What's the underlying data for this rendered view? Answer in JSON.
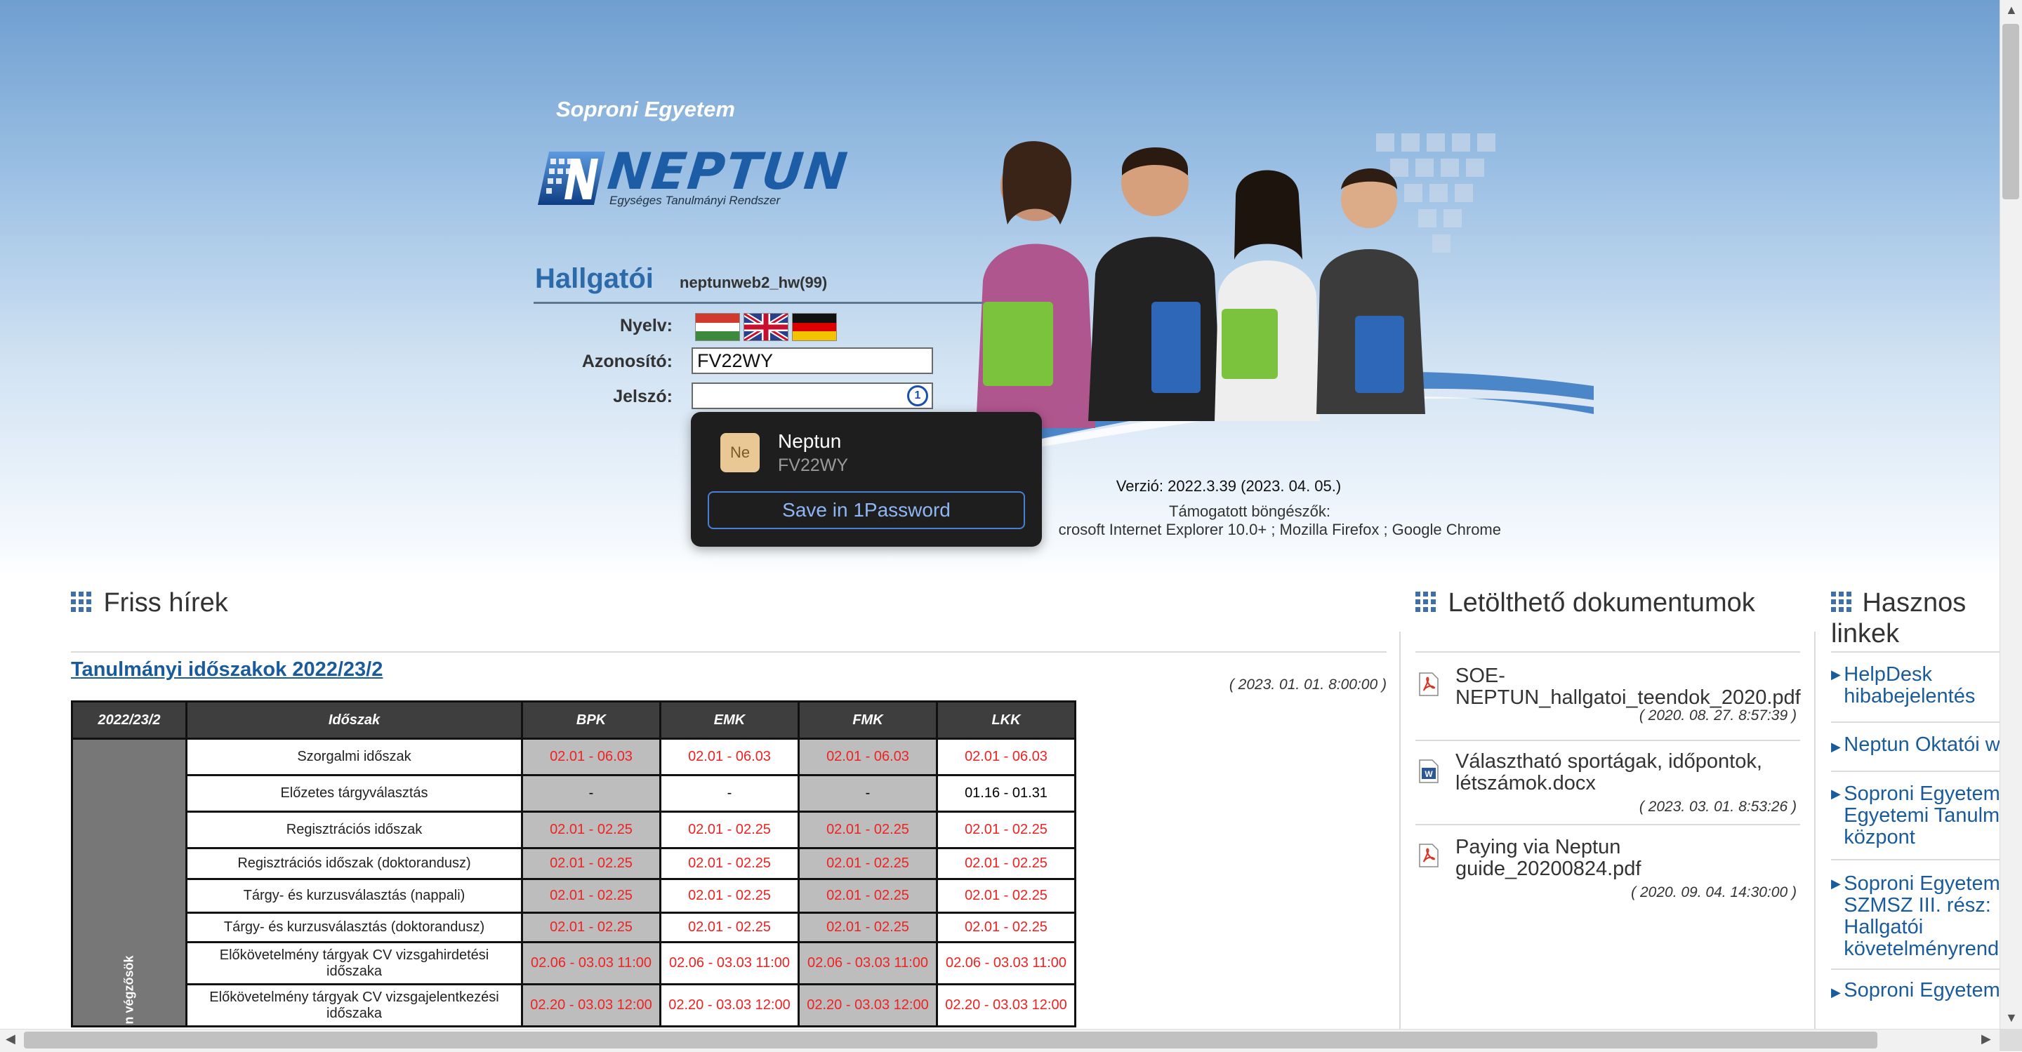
{
  "header": {
    "university": "Soproni Egyetem",
    "logo_word": "NEPTUN",
    "logo_sub": "Egységes Tanulmányi Rendszer",
    "portal": "Hallgatói",
    "server": "neptunweb2_hw(99)"
  },
  "login": {
    "language_label": "Nyelv:",
    "username_label": "Azonosító:",
    "username_value": "FV22WY",
    "password_label": "Jelszó:",
    "password_value": "",
    "onepassword_icon": "1password-icon"
  },
  "popup": {
    "badge": "Ne",
    "title": "Neptun",
    "subtitle": "FV22WY",
    "save_button": "Save in 1Password"
  },
  "version": {
    "text": "Verzió: 2022.3.39 (2023. 04. 05.)",
    "supported_label": "Támogatott böngészők:",
    "supported_list": "crosoft Internet Explorer 10.0+ ; Mozilla Firefox ; Google Chrome"
  },
  "news": {
    "title": "Friss hírek",
    "item_title": "Tanulmányi időszakok 2022/23/2",
    "item_date": "( 2023. 01. 01. 8:00:00 )",
    "table": {
      "headers": [
        "2022/23/2",
        "Időszak",
        "BPK",
        "EMK",
        "FMK",
        "LKK"
      ],
      "side_label": "n végzősök",
      "rows": [
        {
          "period": "Szorgalmi időszak",
          "cells": [
            "02.01 - 06.03",
            "02.01 - 06.03",
            "02.01 - 06.03",
            "02.01 - 06.03"
          ]
        },
        {
          "period": "Előzetes tárgyválasztás",
          "cells": [
            "-",
            "-",
            "-",
            "01.16 - 01.31"
          ]
        },
        {
          "period": "Regisztrációs időszak",
          "cells": [
            "02.01 - 02.25",
            "02.01 - 02.25",
            "02.01 - 02.25",
            "02.01 - 02.25"
          ]
        },
        {
          "period": "Regisztrációs időszak (doktorandusz)",
          "cells": [
            "02.01 - 02.25",
            "02.01 - 02.25",
            "02.01 - 02.25",
            "02.01 - 02.25"
          ]
        },
        {
          "period": "Tárgy- és kurzusválasztás (nappali)",
          "cells": [
            "02.01 - 02.25",
            "02.01 - 02.25",
            "02.01 - 02.25",
            "02.01 - 02.25"
          ]
        },
        {
          "period": "Tárgy- és kurzusválasztás (doktorandusz)",
          "cells": [
            "02.01 - 02.25",
            "02.01 - 02.25",
            "02.01 - 02.25",
            "02.01 - 02.25"
          ]
        },
        {
          "period": "Előkövetelmény tárgyak CV vizsgahirdetési időszaka",
          "cells": [
            "02.06 - 03.03 11:00",
            "02.06 - 03.03 11:00",
            "02.06 - 03.03 11:00",
            "02.06 - 03.03 11:00"
          ]
        },
        {
          "period": "Előkövetelmény tárgyak CV vizsgajelentkezési időszaka",
          "cells": [
            "02.20 - 03.03 12:00",
            "02.20 - 03.03 12:00",
            "02.20 - 03.03 12:00",
            "02.20 - 03.03 12:00"
          ]
        }
      ]
    }
  },
  "documents": {
    "title": "Letölthető dokumentumok",
    "items": [
      {
        "name": "SOE-NEPTUN_hallgatoi_teendok_2020.pdf",
        "date": "( 2020. 08. 27. 8:57:39 )",
        "icon": "pdf-icon"
      },
      {
        "name": "Választható sportágak, időpontok, létszámok.docx",
        "date": "( 2023. 03. 01. 8:53:26 )",
        "icon": "word-doc-icon"
      },
      {
        "name": "Paying via Neptun guide_20200824.pdf",
        "date": "( 2020. 09. 04. 14:30:00 )",
        "icon": "pdf-icon"
      }
    ]
  },
  "links": {
    "title_line1": "Hasznos",
    "title_line2": "linkek",
    "items": [
      {
        "label": "HelpDesk hibabejelentés"
      },
      {
        "label": "Neptun Oktatói w"
      },
      {
        "label": "Soproni Egyetem Egyetemi Tanulmá központ"
      },
      {
        "label": "Soproni Egyetem SZMSZ III. rész: Hallgatói követelményrends"
      },
      {
        "label": "Soproni Egyetem"
      }
    ]
  },
  "colors": {
    "accent": "#1a5b9b",
    "red_dates": "#e22222",
    "popup_bg": "#1e1e1e"
  }
}
